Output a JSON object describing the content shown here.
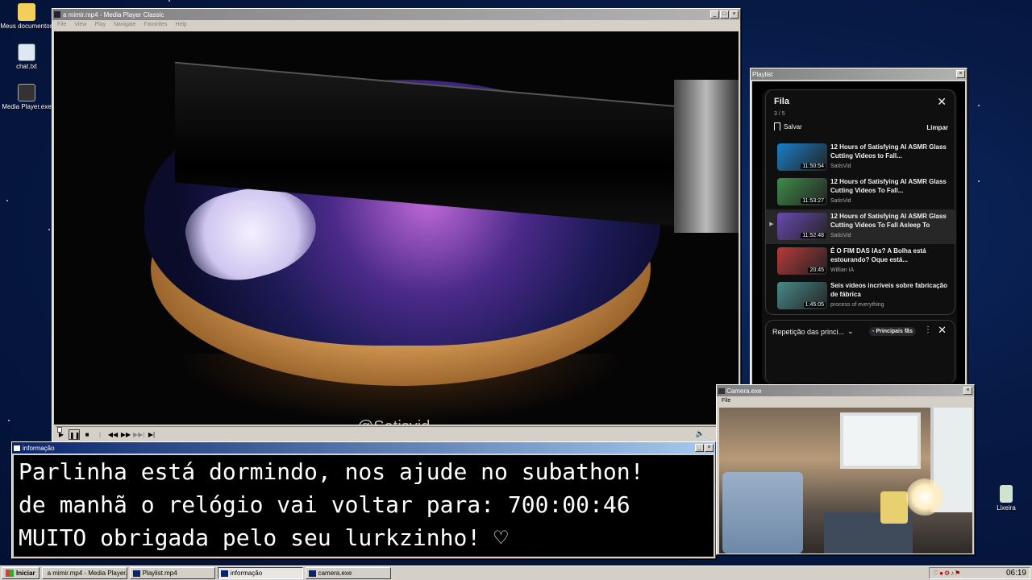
{
  "desktop": {
    "icons": [
      {
        "label": "Meus documentos",
        "icon": "folder-icon"
      },
      {
        "label": "chat.txt",
        "icon": "text-file-icon"
      },
      {
        "label": "Media Player.exe",
        "icon": "media-player-icon"
      },
      {
        "label": "Lixeira",
        "icon": "recycle-bin-icon"
      }
    ]
  },
  "mpc": {
    "title": "a mimir.mp4 - Media Player Classic",
    "menu": [
      "File",
      "View",
      "Play",
      "Navigate",
      "Favorites",
      "Help"
    ],
    "watermark": "@Satisvid",
    "seek_fraction": 0.0
  },
  "playlist": {
    "title": "Playlist",
    "queue_title": "Fila",
    "count": "3 / 5",
    "save_label": "Salvar",
    "clear_label": "Limpar",
    "items": [
      {
        "title": "12 Hours of Satisfying AI ASMR Glass Cutting Videos to Fall...",
        "channel": "SatisVid",
        "duration": "11:50:54",
        "active": false
      },
      {
        "title": "12 Hours of Satisfying AI ASMR Glass Cutting Videos To Fall...",
        "channel": "SatisVid",
        "duration": "11:53:27",
        "active": false
      },
      {
        "title": "12 Hours of Satisfying AI ASMR Glass Cutting Videos To Fall Asleep To",
        "channel": "SatisVid",
        "duration": "11:52:48",
        "active": true
      },
      {
        "title": "É O FIM DAS IAs? A Bolha está estourando? Oque está...",
        "channel": "Willian IA",
        "duration": "20:45",
        "active": false
      },
      {
        "title": "Seis vídeos incríveis sobre fabricação de fábrica",
        "channel": "process of everything",
        "duration": "1:45:05",
        "active": false
      }
    ],
    "repeat_label": "Repetição das princi...",
    "fans_label": "Principais fãs"
  },
  "info": {
    "title": "informação",
    "lines": [
      "Parlinha está dormindo, nos ajude no subathon!",
      "de manhã o relógio vai voltar para:  700:00:46",
      "MUITO obrigada pelo seu lurkzinho! ♡"
    ]
  },
  "camera": {
    "title": "Camera.exe",
    "menu_file": "File"
  },
  "taskbar": {
    "start_label": "Iniciar",
    "items": [
      {
        "label": "a mimir.mp4 - Media Player...",
        "pressed": false
      },
      {
        "label": "Playlist.mp4",
        "pressed": false
      },
      {
        "label": "informação",
        "pressed": true
      },
      {
        "label": "camera.exe",
        "pressed": false
      }
    ],
    "clock": "06:19"
  },
  "colors": {
    "desktop_bg": "#071a45",
    "active_title": "#0a246a",
    "youtube_bg": "#0f0f0f"
  }
}
